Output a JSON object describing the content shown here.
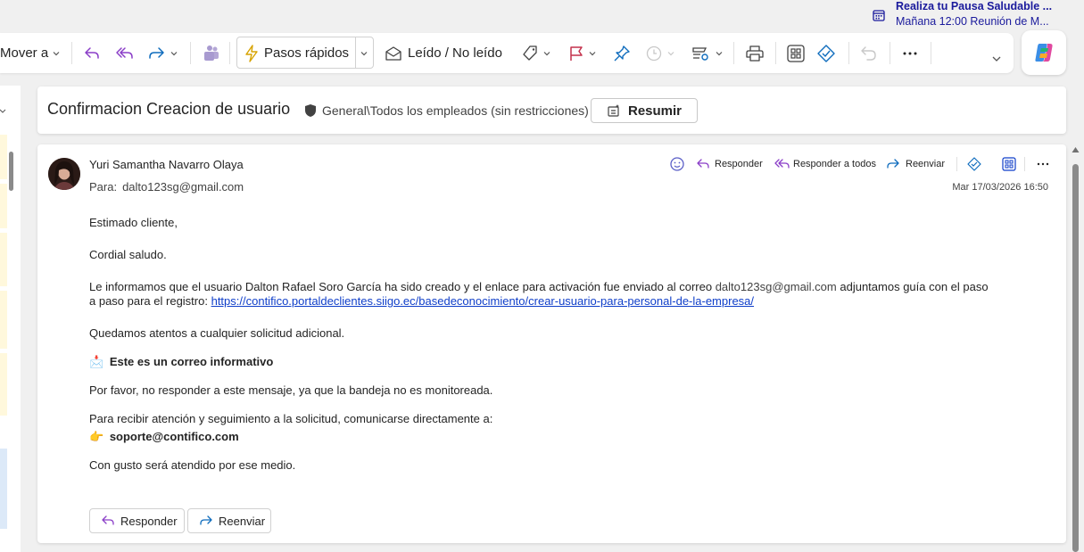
{
  "reminder": {
    "title": "Realiza tu Pausa Saludable ...",
    "detail": "Mañana 12:00 Reunión de M..."
  },
  "toolbar": {
    "move_label": "Mover a",
    "quick_steps_label": "Pasos rápidos",
    "read_unread_label": "Leído / No leído"
  },
  "subject": {
    "title": "Confirmacion Creacion de usuario",
    "sensitivity": "General\\Todos los empleados (sin restricciones)",
    "summarize_label": "Resumir"
  },
  "message": {
    "sender": "Yuri Samantha Navarro Olaya",
    "to_label": "Para:",
    "to_address": "dalto123sg@gmail.com",
    "date": "Mar 17/03/2026 16:50",
    "actions": {
      "reply": "Responder",
      "reply_all": "Responder a todos",
      "forward": "Reenviar"
    },
    "body": {
      "greeting": "Estimado cliente,",
      "salutation": "Cordial saludo.",
      "info_part1": "Le informamos que el usuario Dalton Rafael Soro García ha sido creado y el enlace para activación fue enviado al correo",
      "info_email": "dalto123sg@gmail.com",
      "info_part2": "adjuntamos guía con el paso",
      "info_line2_prefix": "a paso para el registro:",
      "info_link": "https://contifico.portaldeclientes.siigo.ec/basedeconocimiento/crear-usuario-para-personal-de-la-empresa/",
      "attentive": "Quedamos atentos a cualquier solicitud adicional.",
      "informative_title": "Este es un correo informativo",
      "no_reply": "Por favor, no responder a este mensaje, ya que la bandeja no es monitoreada.",
      "contact_intro": "Para recibir atención y seguimiento a la solicitud, comunicarse directamente a:",
      "support_email": "soporte@contifico.com",
      "closing": "Con gusto será atendido por ese medio."
    },
    "bottom_buttons": {
      "reply": "Responder",
      "forward": "Reenviar"
    }
  },
  "icons": {
    "inbox_emoji": "📩",
    "pointing_emoji": "👉"
  },
  "colors": {
    "accent": "#0f6cbd",
    "purple_icon": "#8b3fc8",
    "link": "#0f3ec9",
    "flag": "#c4314b",
    "quick_steps": "#d7a300"
  }
}
